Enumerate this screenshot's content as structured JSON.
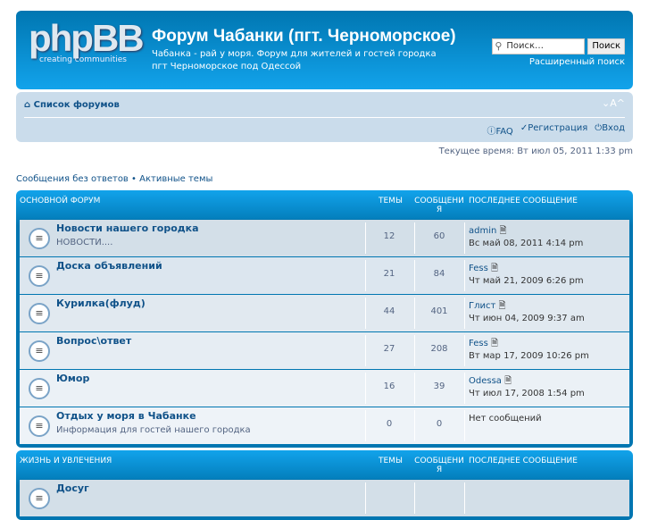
{
  "header": {
    "logo_text": "phpBB",
    "logo_tagline": "creating communities",
    "title": "Форум Чабанки (пгт. Черноморское)",
    "description": "Чабанка - рай у моря. Форум для жителей и гостей городка пгт Черноморское под Одессой",
    "search_placeholder": "Поиск…",
    "search_button": "Поиск",
    "advanced_search": "Расширенный поиск"
  },
  "nav": {
    "home": "Список форумов",
    "font_size": "⌄A^",
    "faq": "FAQ",
    "register": "Регистрация",
    "login": "Вход"
  },
  "current_time": "Текущее время: Вт июл 05, 2011 1:33 pm",
  "links": {
    "unanswered": "Сообщения без ответов",
    "sep": " • ",
    "active": "Активные темы"
  },
  "columns": {
    "topics": "Темы",
    "posts": "Сообщени я",
    "last_post": "Последнее сообщение"
  },
  "categories": [
    {
      "name": "Основной форум",
      "forums": [
        {
          "title": "Новости нашего городка",
          "desc": "НОВОСТИ....",
          "topics": "12",
          "posts": "60",
          "last_author": "admin",
          "last_date": "Вс май 08, 2011 4:14 pm"
        },
        {
          "title": "Доска объявлений",
          "desc": "",
          "topics": "21",
          "posts": "84",
          "last_author": "Fess",
          "last_date": "Чт май 21, 2009 6:26 pm"
        },
        {
          "title": "Курилка(флуд)",
          "desc": "",
          "topics": "44",
          "posts": "401",
          "last_author": "Глист",
          "last_date": "Чт июн 04, 2009 9:37 am"
        },
        {
          "title": "Вопрос\\ответ",
          "desc": "",
          "topics": "27",
          "posts": "208",
          "last_author": "Fess",
          "last_date": "Вт мар 17, 2009 10:26 pm"
        },
        {
          "title": "Юмор",
          "desc": "",
          "topics": "16",
          "posts": "39",
          "last_author": "Odessa",
          "last_date": "Чт июл 17, 2008 1:54 pm"
        },
        {
          "title": "Отдых у моря в Чабанке",
          "desc": "Информация для гостей нашего городка",
          "topics": "0",
          "posts": "0",
          "last_author": "Нет сообщений",
          "last_date": ""
        }
      ]
    },
    {
      "name": "Жизнь и увлечения",
      "forums": [
        {
          "title": "Досуг"
        }
      ]
    }
  ]
}
